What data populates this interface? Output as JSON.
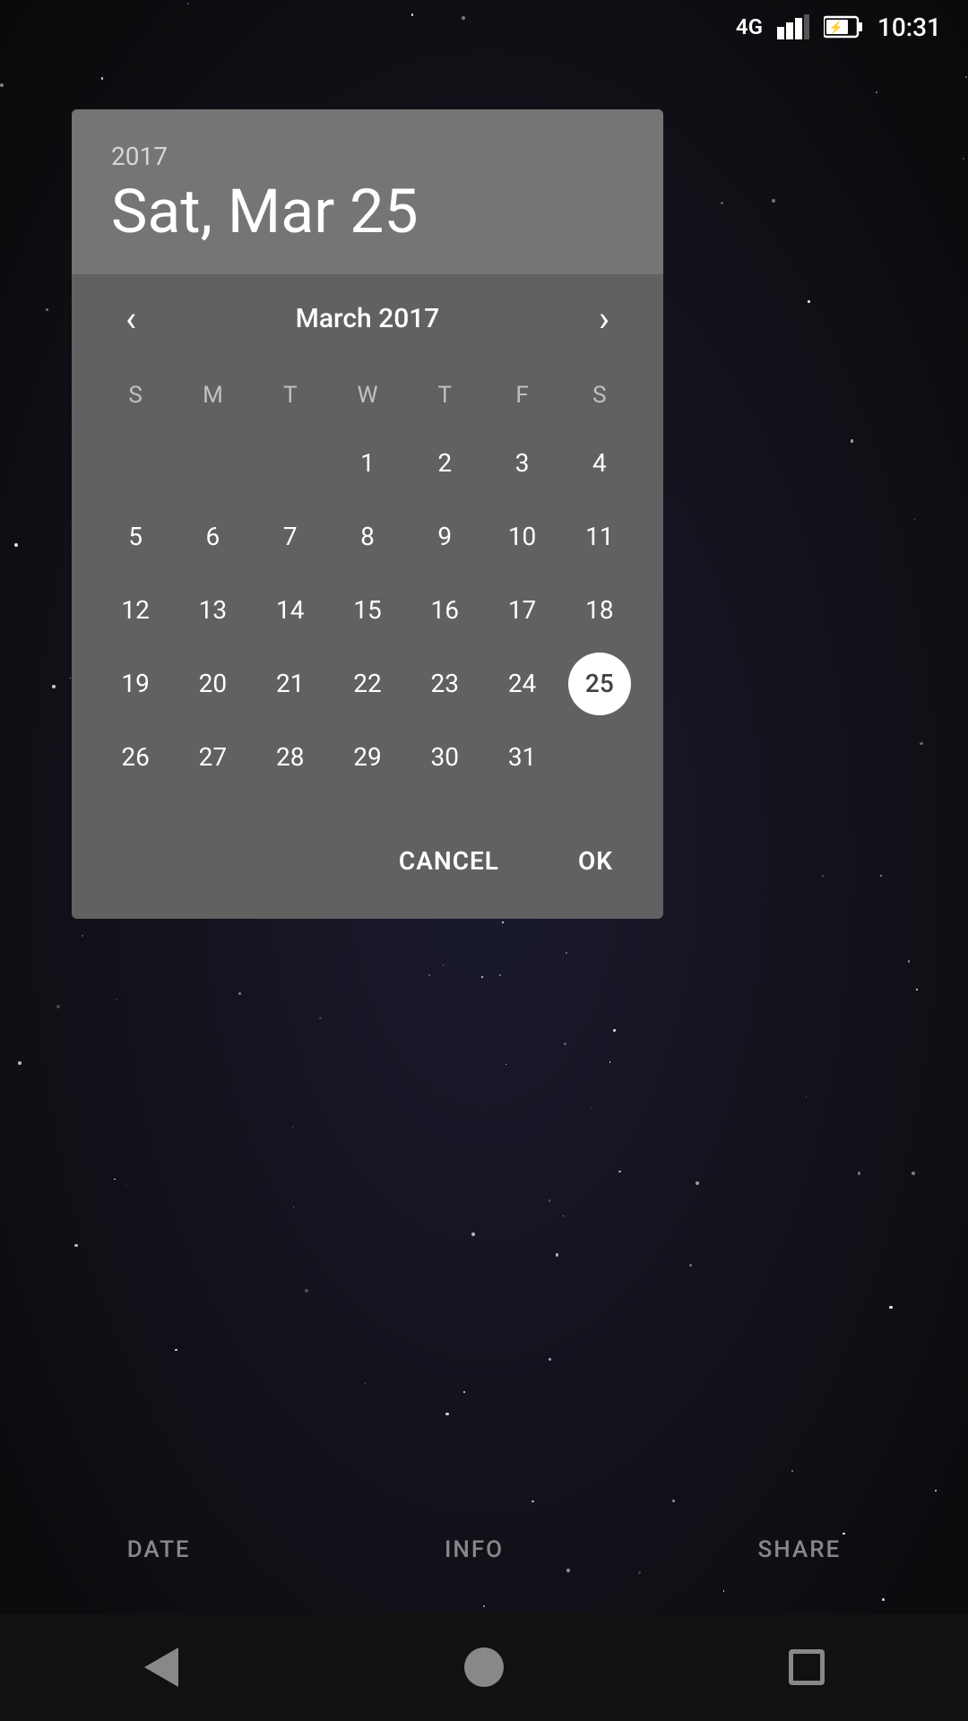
{
  "statusBar": {
    "signal": "4G",
    "time": "10:31"
  },
  "dialog": {
    "year": "2017",
    "selectedDate": "Sat, Mar 25",
    "monthTitle": "March 2017",
    "cancelLabel": "CANCEL",
    "okLabel": "OK"
  },
  "calendar": {
    "dayHeaders": [
      "S",
      "M",
      "T",
      "W",
      "T",
      "F",
      "S"
    ],
    "weeks": [
      [
        "",
        "",
        "",
        "1",
        "2",
        "3",
        "4"
      ],
      [
        "5",
        "6",
        "7",
        "8",
        "9",
        "10",
        "11"
      ],
      [
        "12",
        "13",
        "14",
        "15",
        "16",
        "17",
        "18"
      ],
      [
        "19",
        "20",
        "21",
        "22",
        "23",
        "24",
        "25"
      ],
      [
        "26",
        "27",
        "28",
        "29",
        "30",
        "31",
        ""
      ]
    ],
    "selectedDay": "25"
  },
  "bottomTabs": {
    "date": "DATE",
    "info": "INFO",
    "share": "SHARE"
  },
  "navBar": {
    "back": "back",
    "home": "home",
    "recent": "recent"
  }
}
